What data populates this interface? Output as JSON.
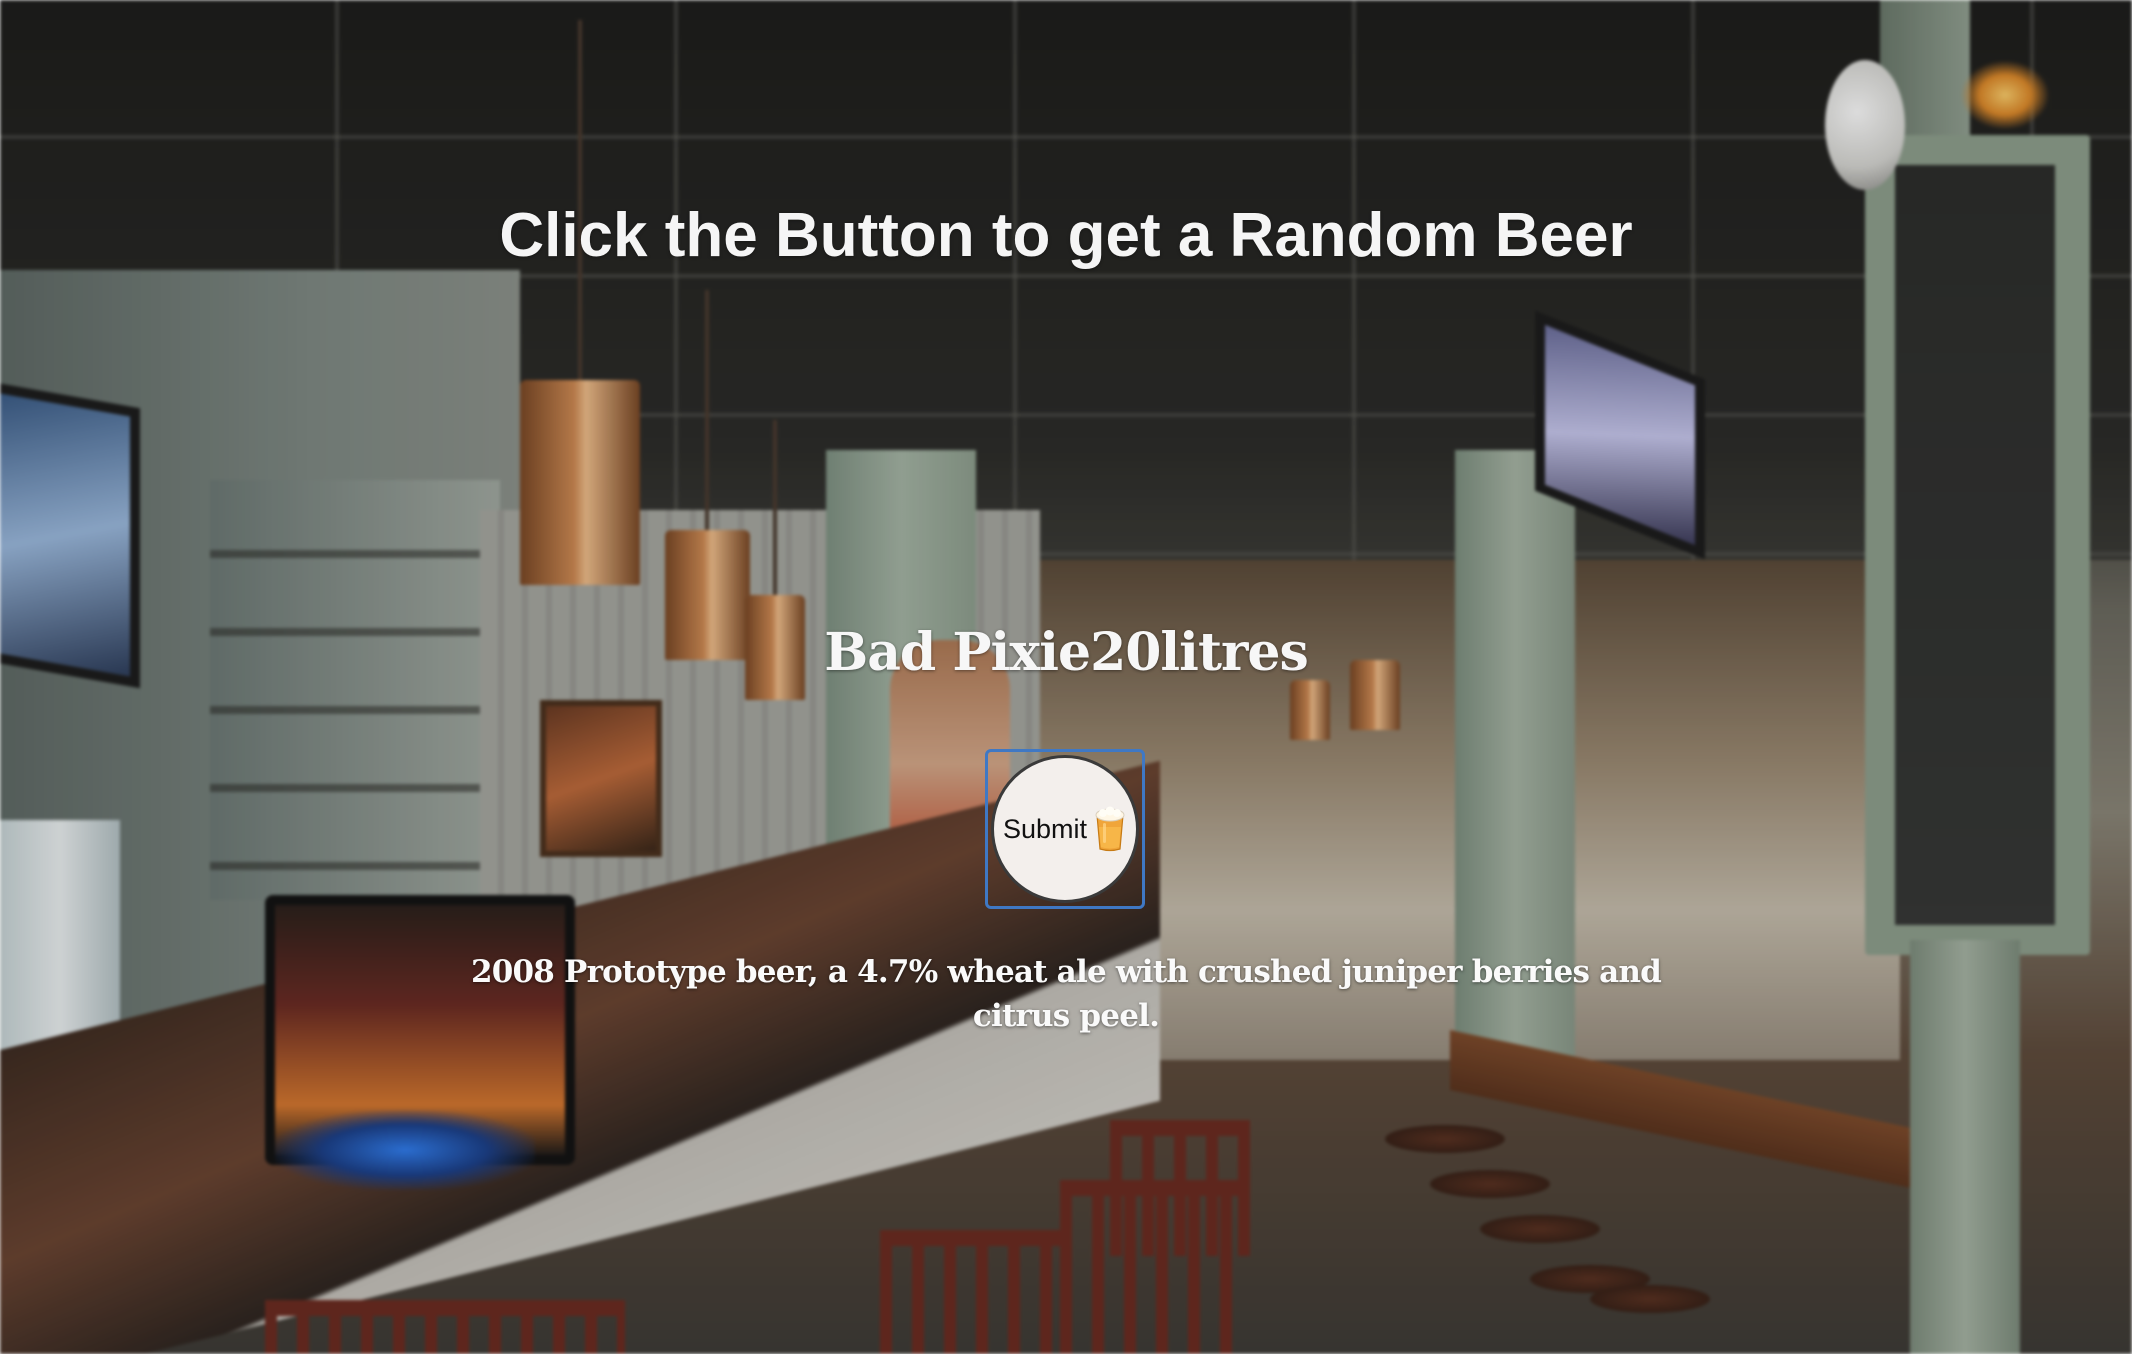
{
  "page": {
    "heading": "Click the Button to get a Random Beer"
  },
  "beer": {
    "name": "Bad Pixie20litres",
    "description": "2008 Prototype beer, a 4.7% wheat ale with crushed juniper berries and citrus peel."
  },
  "submit_button": {
    "label": "Submit",
    "icon": "beer-mug-icon",
    "border_color": "#3f78c4",
    "fill_color": "#f3efec"
  },
  "background": {
    "icon": "bar-interior-photo"
  }
}
